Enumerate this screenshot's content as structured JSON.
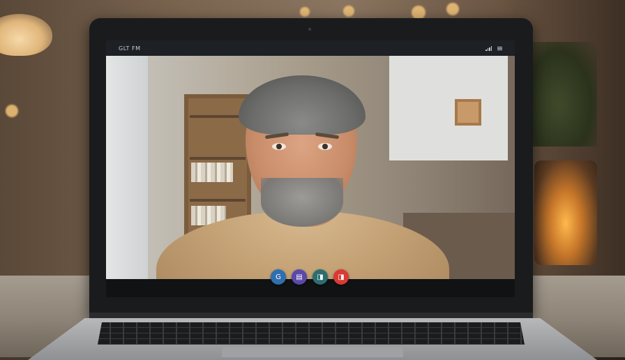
{
  "app": {
    "title": "GLT FM",
    "status_icons": [
      "signal-icon",
      "menu-icon"
    ]
  },
  "call_controls": [
    {
      "name": "participants-button",
      "icon": "g-logo-icon",
      "glyph": "G",
      "color": "#2f6fae"
    },
    {
      "name": "chat-button",
      "icon": "chat-icon",
      "glyph": "▤",
      "color": "#5b49a8"
    },
    {
      "name": "camera-button",
      "icon": "camera-icon",
      "glyph": "◨",
      "color": "#2c6e70"
    },
    {
      "name": "end-call-button",
      "icon": "end-call-icon",
      "glyph": "◨",
      "color": "#d93a33"
    }
  ],
  "colors": {
    "screen_bg": "#0f1113",
    "topbar_bg": "#1d2024",
    "end_call": "#d93a33"
  }
}
